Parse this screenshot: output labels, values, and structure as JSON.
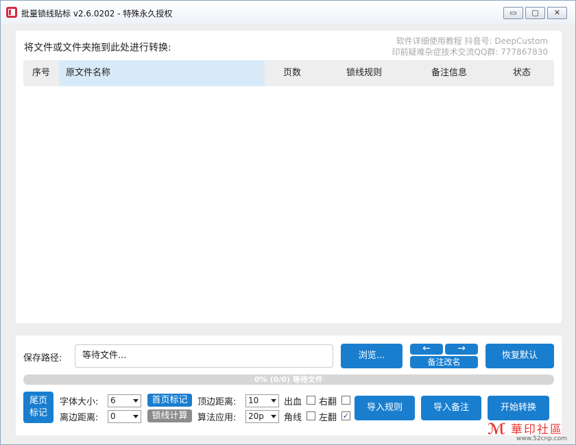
{
  "window": {
    "title": "批量锁线贴标 v2.6.0202 - 特殊永久授权",
    "minimize": "▭",
    "maximize": "▢",
    "close": "✕"
  },
  "main": {
    "drop_hint": "将文件或文件夹拖到此处进行转换:",
    "promo_line1": "软件详细使用教程  抖音号: DeepCustom",
    "promo_line2": "印前疑难杂症技术交流QQ群: 777867830",
    "columns": [
      "序号",
      "原文件名称",
      "页数",
      "锁线规则",
      "备注信息",
      "状态"
    ]
  },
  "bottom": {
    "save_label": "保存路径:",
    "save_value": "等待文件...",
    "browse": "浏览...",
    "arrow_left": "←",
    "arrow_right": "→",
    "rename": "备注改名",
    "reset": "恢复默认",
    "progress_text": "0% (0/0) 等待文件",
    "progress_fraction": 0,
    "last_page_mark": "尾页\n标记",
    "font_size_label": "字体大小:",
    "font_size_value": "6",
    "margin_label": "离边距离:",
    "margin_value": "0",
    "first_page_mark": "首页标记",
    "spine_calc": "锁线计算",
    "top_dist_label": "顶边距离:",
    "top_dist_value": "10",
    "algo_label": "算法应用:",
    "algo_value": "20p",
    "bleed_label": "出血",
    "corner_label": "角线",
    "right_flip_label": "右翻",
    "left_flip_label": "左翻",
    "bleed_checked": false,
    "corner_checked": false,
    "right_flip_checked": false,
    "left_flip_checked": true,
    "import_rule": "导入规则",
    "import_note": "导入备注",
    "start": "开始转换"
  },
  "watermark": {
    "title": "華印社區",
    "url": "www.52cnp.com",
    "icon": "logo-icon"
  }
}
